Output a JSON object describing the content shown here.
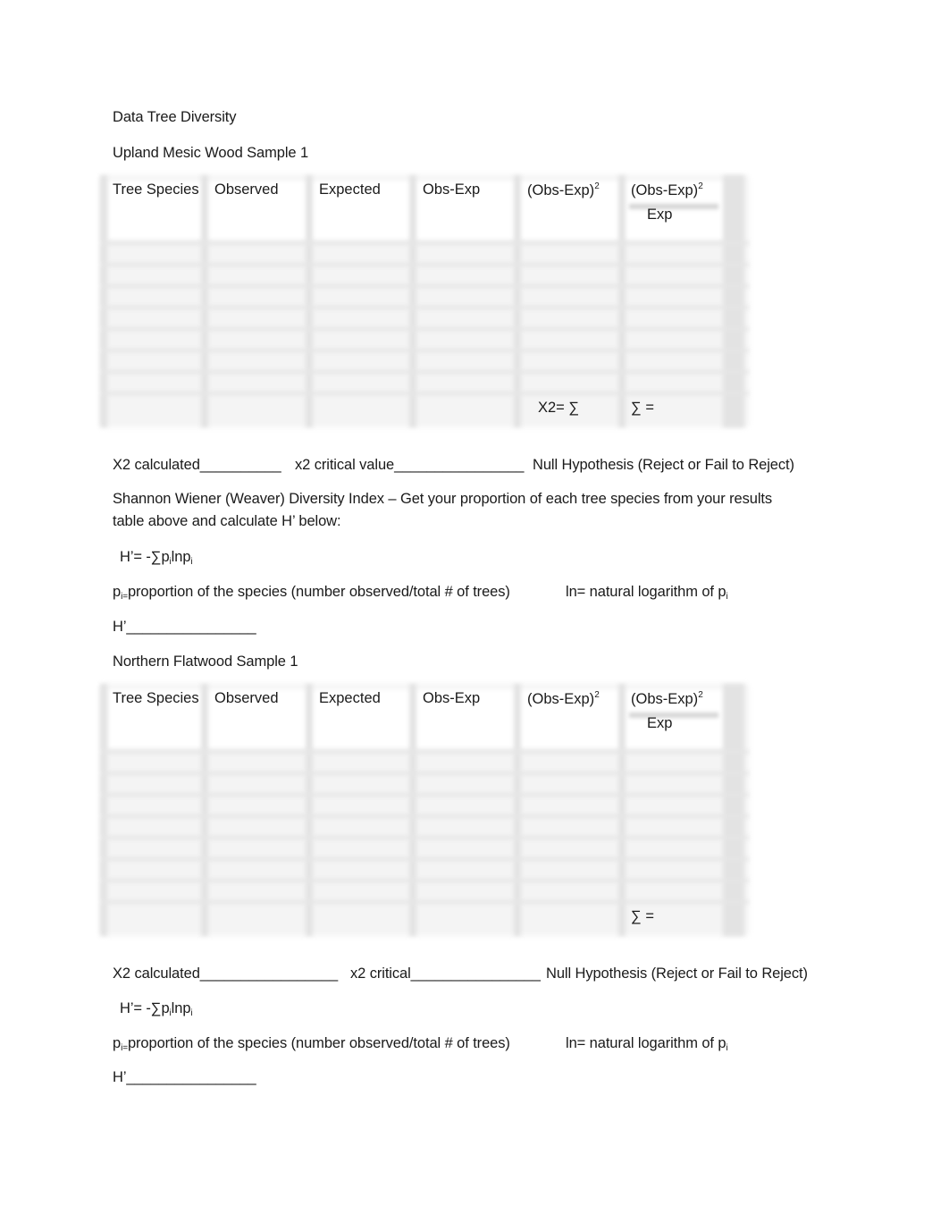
{
  "document": {
    "title": "Data Tree Diversity",
    "sections": [
      {
        "heading": "Upland Mesic Wood Sample 1",
        "table": {
          "columns": [
            "Tree Species",
            "Observed",
            "Expected",
            "Obs-Exp",
            "(Obs-Exp)",
            "(Obs-Exp)"
          ],
          "superscript": "2",
          "fraction_denominator": "Exp",
          "rows": [
            [
              "",
              "",
              "",
              "",
              "",
              ""
            ],
            [
              "",
              "",
              "",
              "",
              "",
              ""
            ],
            [
              "",
              "",
              "",
              "",
              "",
              ""
            ],
            [
              "",
              "",
              "",
              "",
              "",
              ""
            ],
            [
              "",
              "",
              "",
              "",
              "",
              ""
            ],
            [
              "",
              "",
              "",
              "",
              "",
              ""
            ],
            [
              "",
              "",
              "",
              "",
              "",
              ""
            ],
            [
              "",
              "",
              "",
              "",
              "",
              ""
            ]
          ],
          "footer": {
            "col5": "X2= ∑",
            "col6": "∑ ="
          }
        },
        "results_line": {
          "x2_calculated": "X2 calculated__________",
          "x2_critical": "x2 critical value________________",
          "null_hypothesis": "Null Hypothesis (Reject or Fail to Reject)"
        },
        "shannon_intro_line1": "Shannon Wiener (Weaver) Diversity Index – Get your proportion of each tree species from your results",
        "shannon_intro_line2": "table above and calculate H’ below:",
        "formula": {
          "prefix": "H’= -∑p",
          "sub1": "i",
          "mid": "lnp",
          "sub2": "i"
        },
        "definition": {
          "p": "p",
          "p_sub": "i=",
          "text": "proportion of the species (number observed/total # of trees)",
          "ln_text": "ln= natural logarithm of p",
          "ln_sub": "i"
        },
        "h_blank": "H’________________"
      },
      {
        "heading": "Northern Flatwood Sample 1",
        "table": {
          "columns": [
            "Tree Species",
            "Observed",
            "Expected",
            "Obs-Exp",
            "(Obs-Exp)",
            "(Obs-Exp)"
          ],
          "superscript": "2",
          "fraction_denominator": "Exp",
          "rows": [
            [
              "",
              "",
              "",
              "",
              "",
              ""
            ],
            [
              "",
              "",
              "",
              "",
              "",
              ""
            ],
            [
              "",
              "",
              "",
              "",
              "",
              ""
            ],
            [
              "",
              "",
              "",
              "",
              "",
              ""
            ],
            [
              "",
              "",
              "",
              "",
              "",
              ""
            ],
            [
              "",
              "",
              "",
              "",
              "",
              ""
            ],
            [
              "",
              "",
              "",
              "",
              "",
              ""
            ],
            [
              "",
              "",
              "",
              "",
              "",
              ""
            ]
          ],
          "footer": {
            "col5": "",
            "col6": "∑ ="
          }
        },
        "results_line": {
          "x2_calculated": "X2 calculated_________________",
          "x2_critical": "x2 critical________________",
          "null_hypothesis": "Null Hypothesis (Reject or Fail to Reject)"
        },
        "formula": {
          "prefix": "H’= -∑p",
          "sub1": "i",
          "mid": "lnp",
          "sub2": "i"
        },
        "definition": {
          "p": "p",
          "p_sub": "i=",
          "text": "proportion of the species (number observed/total # of trees)",
          "ln_text": "ln= natural logarithm of p",
          "ln_sub": "i"
        },
        "h_blank": "H’________________"
      }
    ]
  }
}
